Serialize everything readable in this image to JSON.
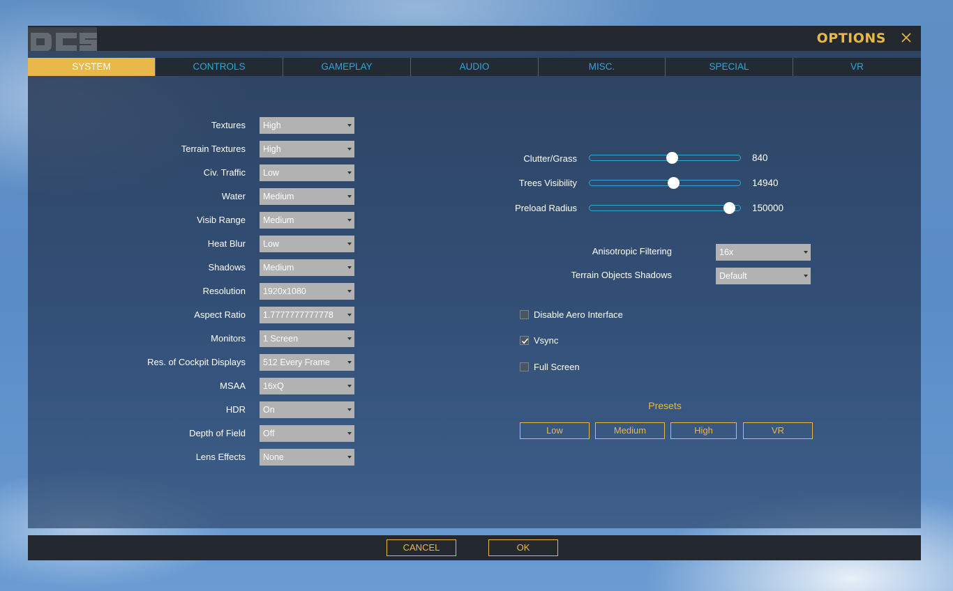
{
  "window": {
    "title": "OPTIONS"
  },
  "tabs": [
    {
      "label": "SYSTEM",
      "active": true
    },
    {
      "label": "CONTROLS",
      "active": false
    },
    {
      "label": "GAMEPLAY",
      "active": false
    },
    {
      "label": "AUDIO",
      "active": false
    },
    {
      "label": "MISC.",
      "active": false
    },
    {
      "label": "SPECIAL",
      "active": false
    },
    {
      "label": "VR",
      "active": false
    }
  ],
  "settings": [
    {
      "label": "Textures",
      "value": "High"
    },
    {
      "label": "Terrain Textures",
      "value": "High"
    },
    {
      "label": "Civ. Traffic",
      "value": "Low"
    },
    {
      "label": "Water",
      "value": "Medium"
    },
    {
      "label": "Visib Range",
      "value": "Medium"
    },
    {
      "label": "Heat Blur",
      "value": "Low"
    },
    {
      "label": "Shadows",
      "value": "Medium"
    },
    {
      "label": "Resolution",
      "value": "1920x1080"
    },
    {
      "label": "Aspect Ratio",
      "value": "1.7777777777778"
    },
    {
      "label": "Monitors",
      "value": "1 Screen"
    },
    {
      "label": "Res. of Cockpit Displays",
      "value": "512 Every Frame"
    },
    {
      "label": "MSAA",
      "value": "16xQ"
    },
    {
      "label": "HDR",
      "value": "On"
    },
    {
      "label": "Depth of Field",
      "value": "Off"
    },
    {
      "label": "Lens Effects",
      "value": "None"
    }
  ],
  "sliders": [
    {
      "label": "Clutter/Grass",
      "value": "840",
      "level": 0.55
    },
    {
      "label": "Trees Visibility",
      "value": "14940",
      "level": 0.56
    },
    {
      "label": "Preload Radius",
      "value": "150000",
      "level": 0.96
    }
  ],
  "right_dropdowns": [
    {
      "label": "Anisotropic Filtering",
      "value": "16x"
    },
    {
      "label": "Terrain Objects Shadows",
      "value": "Default"
    }
  ],
  "checkboxes": [
    {
      "label": "Disable Aero Interface",
      "checked": false
    },
    {
      "label": "Vsync",
      "checked": true
    },
    {
      "label": "Full Screen",
      "checked": false
    }
  ],
  "presets": {
    "title": "Presets",
    "buttons": [
      "Low",
      "Medium",
      "High",
      "VR"
    ]
  },
  "footer": {
    "cancel": "CANCEL",
    "ok": "OK"
  },
  "colors": {
    "accent": "#e8b84a",
    "tab_text": "#2fa8d8",
    "dropdown_bg": "#b2b2b2"
  }
}
